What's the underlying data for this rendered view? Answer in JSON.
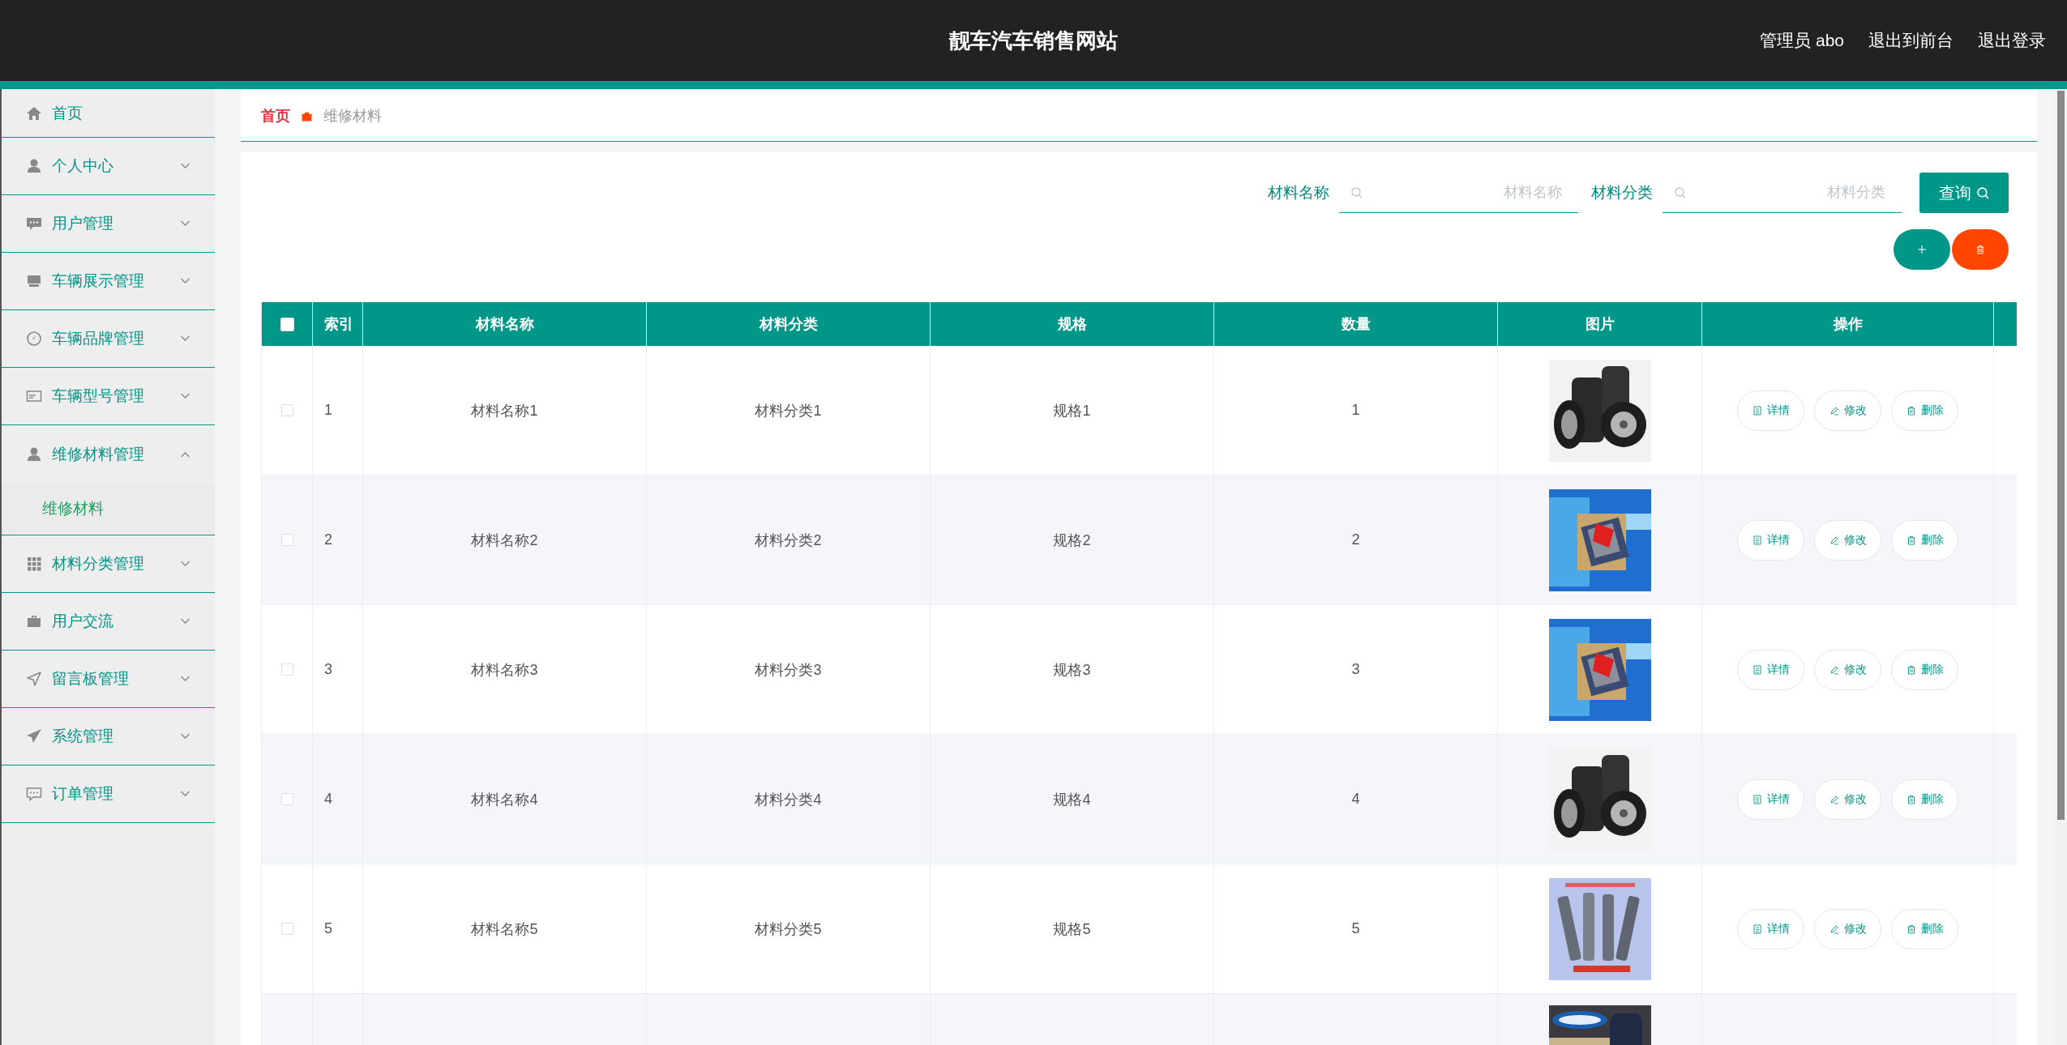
{
  "header": {
    "title": "靓车汽车销售网站",
    "links": [
      "管理员 abo",
      "退出到前台",
      "退出登录"
    ]
  },
  "sidebar": {
    "items": [
      {
        "label": "首页",
        "kind": "link"
      },
      {
        "label": "个人中心",
        "kind": "menu",
        "expanded": false
      },
      {
        "label": "用户管理",
        "kind": "menu",
        "expanded": false
      },
      {
        "label": "车辆展示管理",
        "kind": "menu",
        "expanded": false
      },
      {
        "label": "车辆品牌管理",
        "kind": "menu",
        "expanded": false
      },
      {
        "label": "车辆型号管理",
        "kind": "menu",
        "expanded": false
      },
      {
        "label": "维修材料管理",
        "kind": "menu",
        "expanded": true,
        "children": [
          {
            "label": "维修材料",
            "selected": true
          }
        ]
      },
      {
        "label": "材料分类管理",
        "kind": "menu",
        "expanded": false
      },
      {
        "label": "用户交流",
        "kind": "menu",
        "expanded": false
      },
      {
        "label": "留言板管理",
        "kind": "menu",
        "expanded": false
      },
      {
        "label": "系统管理",
        "kind": "menu",
        "expanded": false
      },
      {
        "label": "订单管理",
        "kind": "menu",
        "expanded": false
      }
    ]
  },
  "breadcrumb": [
    "首页",
    "维修材料"
  ],
  "search": {
    "fields": [
      {
        "label": "材料名称",
        "placeholder": "材料名称"
      },
      {
        "label": "材料分类",
        "placeholder": "材料分类"
      }
    ],
    "button": "查询"
  },
  "table": {
    "select_all": {
      "checked": false
    },
    "columns": [
      "索引",
      "材料名称",
      "材料分类",
      "规格",
      "数量",
      "图片",
      "操作"
    ],
    "rows": [
      {
        "checked": false,
        "cells": [
          "1",
          "材料名称1",
          "材料分类1",
          "规格1",
          "1"
        ],
        "actions": [
          "详情",
          "修改",
          "删除"
        ]
      },
      {
        "checked": false,
        "cells": [
          "2",
          "材料名称2",
          "材料分类2",
          "规格2",
          "2"
        ],
        "actions": [
          "详情",
          "修改",
          "删除"
        ]
      },
      {
        "checked": false,
        "cells": [
          "3",
          "材料名称3",
          "材料分类3",
          "规格3",
          "3"
        ],
        "actions": [
          "详情",
          "修改",
          "删除"
        ]
      },
      {
        "checked": false,
        "cells": [
          "4",
          "材料名称4",
          "材料分类4",
          "规格4",
          "4"
        ],
        "actions": [
          "详情",
          "修改",
          "删除"
        ]
      },
      {
        "checked": false,
        "cells": [
          "5",
          "材料名称5",
          "材料分类5",
          "规格5",
          "5"
        ],
        "actions": [
          "详情",
          "修改",
          "删除"
        ]
      }
    ]
  }
}
